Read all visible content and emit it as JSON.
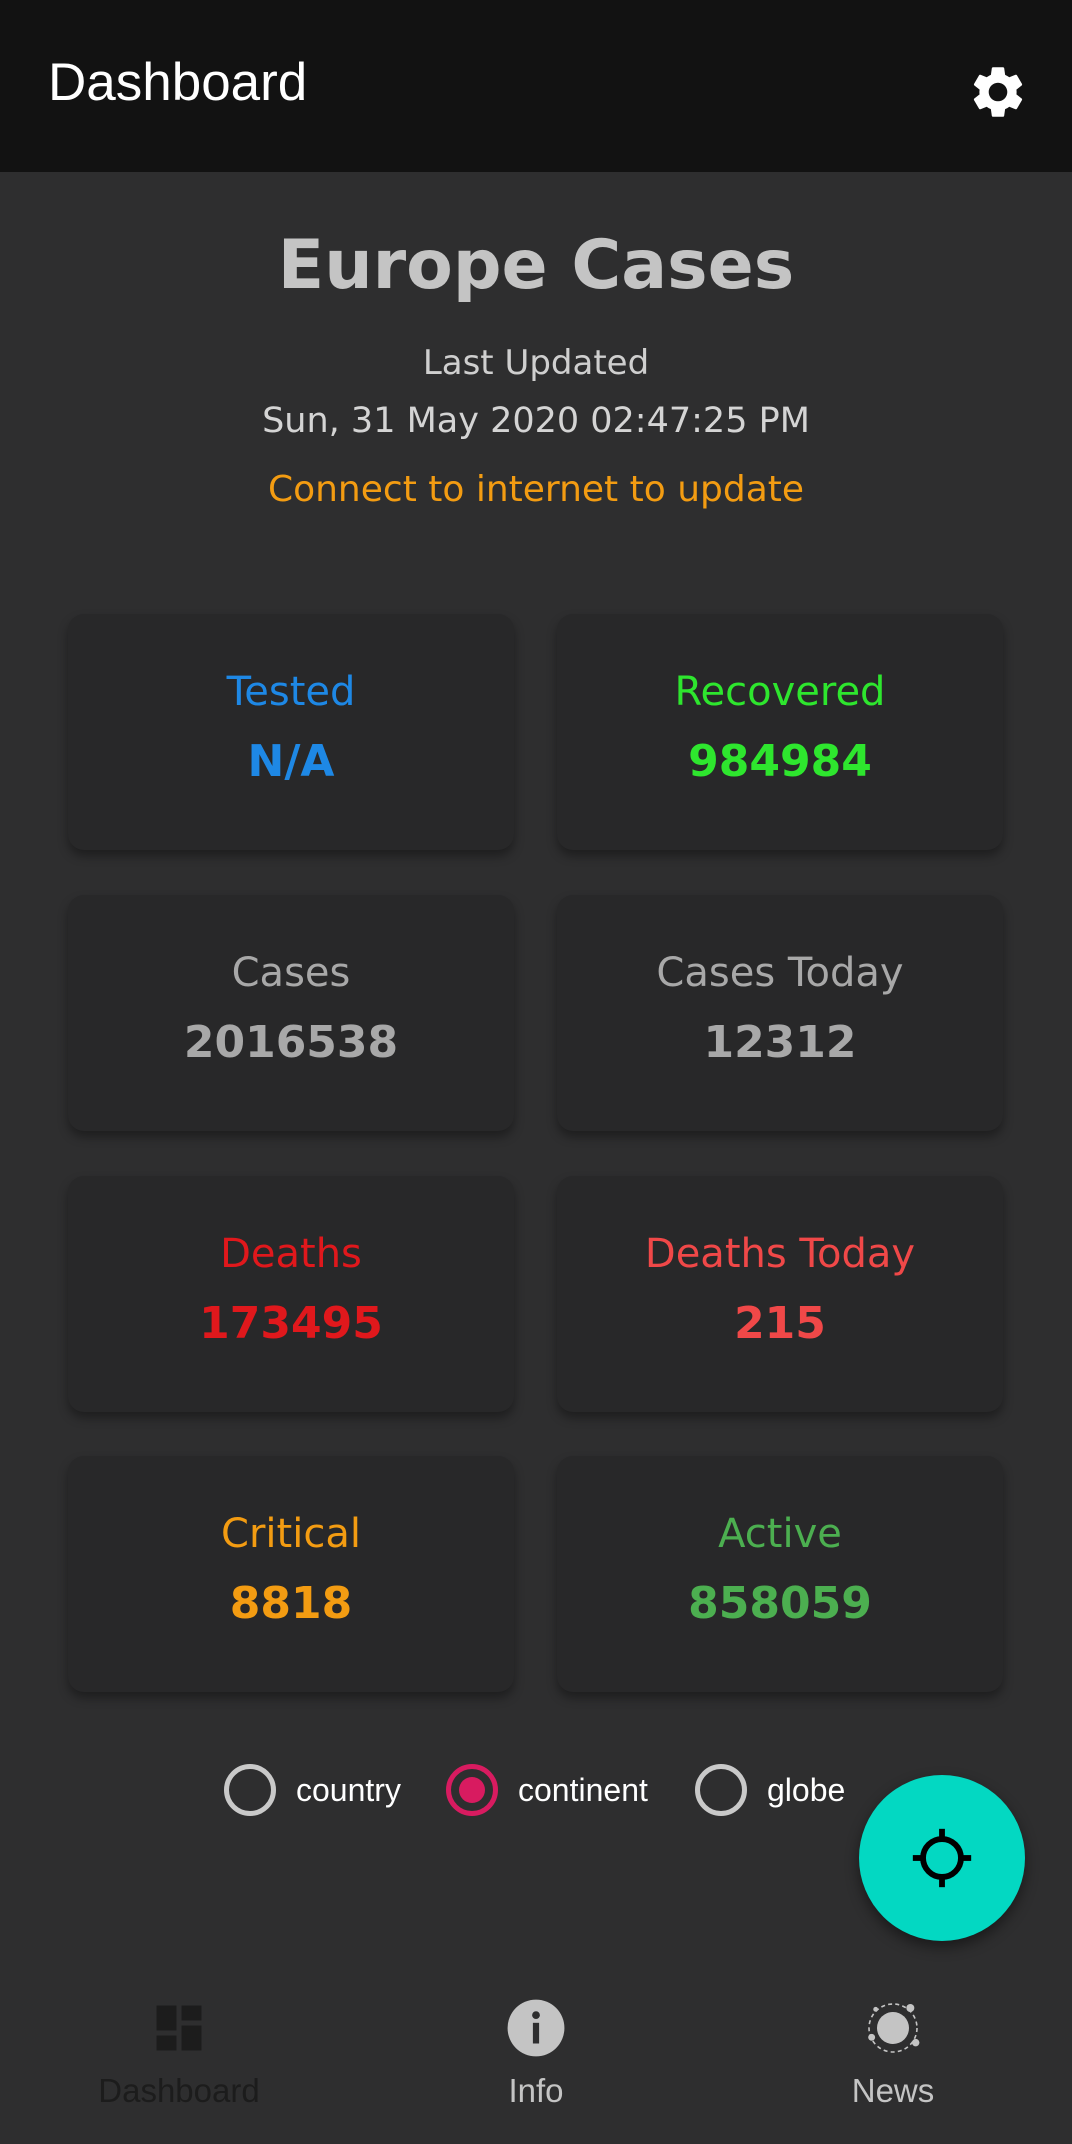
{
  "appbar": {
    "title": "Dashboard",
    "settings_icon": "gear-icon"
  },
  "header": {
    "title": "Europe Cases",
    "updated_label": "Last Updated",
    "updated_time": "Sun, 31 May 2020 02:47:25 PM",
    "offline_message": "Connect to internet to update"
  },
  "stats": {
    "tested": {
      "label": "Tested",
      "value": "N/A",
      "color": "#1e88e5"
    },
    "recovered": {
      "label": "Recovered",
      "value": "984984",
      "color": "#2ee62e"
    },
    "cases": {
      "label": "Cases",
      "value": "2016538",
      "color": "#a8a8a8"
    },
    "cases_today": {
      "label": "Cases Today",
      "value": "12312",
      "color": "#a8a8a8"
    },
    "deaths": {
      "label": "Deaths",
      "value": "173495",
      "color": "#e0181c"
    },
    "deaths_today": {
      "label": "Deaths Today",
      "value": "215",
      "color": "#f04848"
    },
    "critical": {
      "label": "Critical",
      "value": "8818",
      "color": "#f39c12"
    },
    "active": {
      "label": "Active",
      "value": "858059",
      "color": "#4caf50"
    }
  },
  "scope": {
    "options": [
      "country",
      "continent",
      "globe"
    ],
    "selected": "continent",
    "accent_color": "#d81b60"
  },
  "fab": {
    "icon": "crosshair-icon",
    "color": "#03d8c2"
  },
  "bottom_nav": {
    "items": [
      {
        "label": "Dashboard",
        "icon": "dashboard-icon",
        "active": true
      },
      {
        "label": "Info",
        "icon": "info-icon",
        "active": false
      },
      {
        "label": "News",
        "icon": "virus-icon",
        "active": false
      }
    ]
  }
}
